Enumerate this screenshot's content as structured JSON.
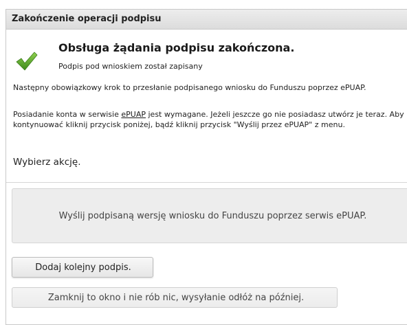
{
  "dialog": {
    "title": "Zakończenie operacji podpisu"
  },
  "status": {
    "icon": "checkmark-icon",
    "icon_color": "#5aa02c",
    "title": "Obsługa żądania podpisu zakończona.",
    "subtitle": "Podpis pod wnioskiem został zapisany"
  },
  "body": {
    "paragraph1": "Następny obowiązkowy krok to przesłanie podpisanego wniosku do Funduszu poprzez ePUAP.",
    "paragraph2_before": "Posiadanie konta w serwisie ",
    "paragraph2_link": "ePUAP",
    "paragraph2_after": " jest wymagane. Jeżeli jeszcze go nie posiadasz utwórz je teraz. Aby kontynuować kliknij przycisk poniżej, bądź kliknij przycisk \"Wyślij przez ePUAP\" z menu.",
    "choose_action": "Wybierz akcję."
  },
  "actions": {
    "send_epuap": "Wyślij podpisaną wersję wniosku do Funduszu poprzez serwis ePUAP.",
    "add_signature": "Dodaj kolejny podpis.",
    "close_later": "Zamknij to okno i nie rób nic, wysyłanie odłóż na później."
  }
}
